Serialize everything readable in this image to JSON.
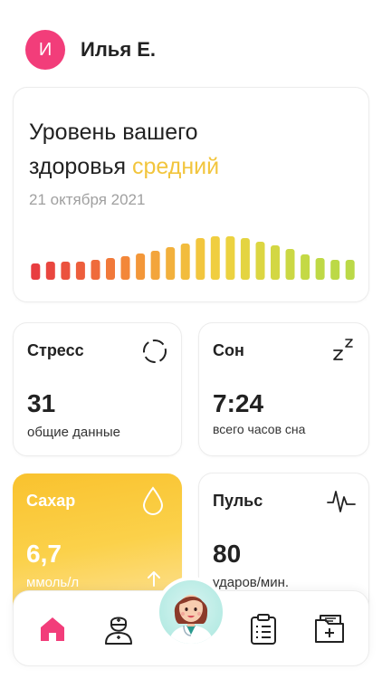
{
  "user": {
    "initial": "И",
    "name": "Илья Е."
  },
  "health": {
    "title_line1": "Уровень вашего",
    "title_line2": "здоровья",
    "level": "средний",
    "date": "21 октября 2021",
    "bars_count": 22,
    "bar_colors": [
      "#e83d40",
      "#e9463f",
      "#eb523e",
      "#ed5e3c",
      "#ef6b3b",
      "#f1793a",
      "#f38739",
      "#f39739",
      "#f3a53b",
      "#f2b03c",
      "#f2bc3d",
      "#f2c63e",
      "#f0ce40",
      "#ecd240",
      "#e4d441",
      "#dcd642",
      "#d3d743",
      "#cbd844",
      "#c4d945",
      "#bfd946",
      "#bcd947",
      "#bbd948"
    ]
  },
  "stress": {
    "title": "Стресс",
    "value": "31",
    "sub": "общие данные"
  },
  "sleep": {
    "title": "Сон",
    "value": "7:24",
    "sub": "всего часов сна"
  },
  "sugar": {
    "title": "Сахар",
    "value": "6,7",
    "sub": "ммоль/л"
  },
  "pulse": {
    "title": "Пульс",
    "value": "80",
    "sub": "ударов/мин."
  },
  "tabbar": {
    "items": [
      "home-icon",
      "doctor-icon",
      "assistant-avatar",
      "checklist-icon",
      "medical-folder-icon"
    ],
    "active_color": "#f23d7a"
  }
}
